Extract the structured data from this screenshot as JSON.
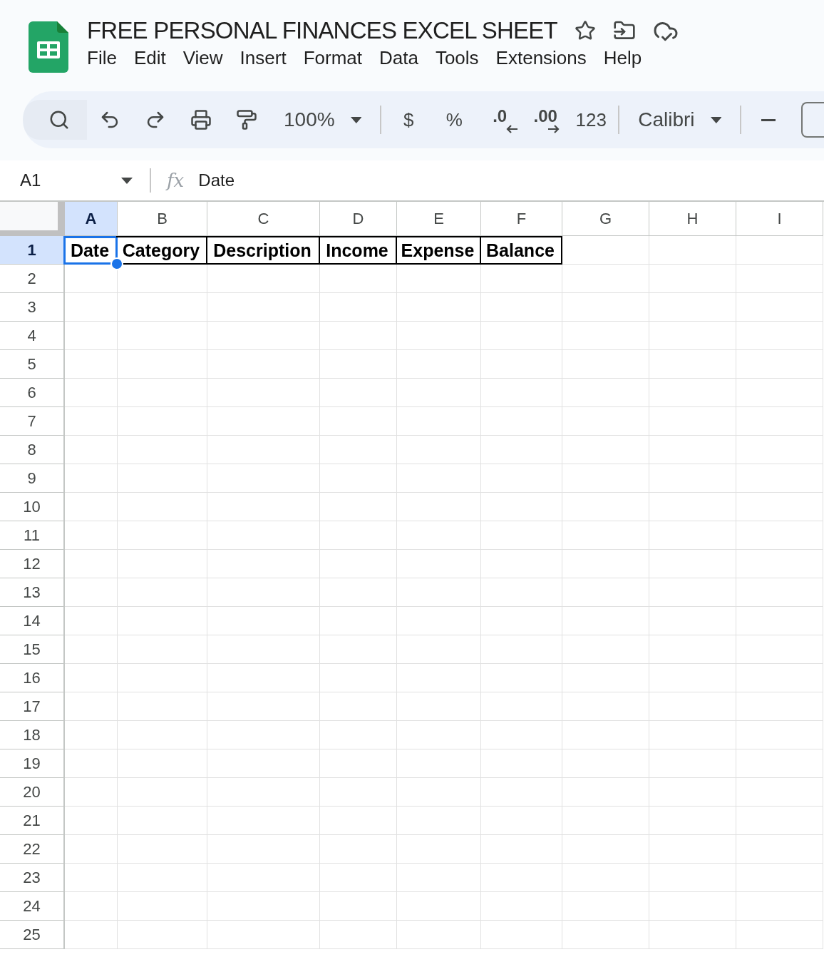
{
  "document": {
    "title": "FREE PERSONAL FINANCES EXCEL SHEET",
    "starred": false
  },
  "menu": [
    "File",
    "Edit",
    "View",
    "Insert",
    "Format",
    "Data",
    "Tools",
    "Extensions",
    "Help"
  ],
  "toolbar": [
    {
      "kind": "search"
    },
    {
      "kind": "undo"
    },
    {
      "kind": "redo"
    },
    {
      "kind": "print"
    },
    {
      "kind": "paint"
    },
    {
      "kind": "select",
      "label": "100%"
    },
    {
      "kind": "divider"
    },
    {
      "kind": "text",
      "label": "$"
    },
    {
      "kind": "text",
      "label": "%"
    },
    {
      "kind": "decimal-less",
      "label": ".0"
    },
    {
      "kind": "decimal-more",
      "label": ".00"
    },
    {
      "kind": "text",
      "label": "123"
    },
    {
      "kind": "divider"
    },
    {
      "kind": "select",
      "label": "Calibri"
    },
    {
      "kind": "divider"
    },
    {
      "kind": "minus"
    }
  ],
  "formula_bar": {
    "name_box": "A1",
    "fx_label": "fx",
    "formula": "Date"
  },
  "columns": [
    {
      "label": "A",
      "selected": true
    },
    {
      "label": "B",
      "selected": false
    },
    {
      "label": "C",
      "selected": false
    },
    {
      "label": "D",
      "selected": false
    },
    {
      "label": "E",
      "selected": false
    },
    {
      "label": "F",
      "selected": false
    },
    {
      "label": "G",
      "selected": false
    },
    {
      "label": "H",
      "selected": false
    },
    {
      "label": "I",
      "selected": false
    }
  ],
  "rows": [
    {
      "label": "1",
      "selected": true
    },
    {
      "label": "2",
      "selected": false
    },
    {
      "label": "3",
      "selected": false
    },
    {
      "label": "4",
      "selected": false
    },
    {
      "label": "5",
      "selected": false
    },
    {
      "label": "6",
      "selected": false
    },
    {
      "label": "7",
      "selected": false
    },
    {
      "label": "8",
      "selected": false
    },
    {
      "label": "9",
      "selected": false
    },
    {
      "label": "10",
      "selected": false
    },
    {
      "label": "11",
      "selected": false
    },
    {
      "label": "12",
      "selected": false
    },
    {
      "label": "13",
      "selected": false
    },
    {
      "label": "14",
      "selected": false
    },
    {
      "label": "15",
      "selected": false
    },
    {
      "label": "16",
      "selected": false
    },
    {
      "label": "17",
      "selected": false
    },
    {
      "label": "18",
      "selected": false
    },
    {
      "label": "19",
      "selected": false
    },
    {
      "label": "20",
      "selected": false
    },
    {
      "label": "21",
      "selected": false
    },
    {
      "label": "22",
      "selected": false
    },
    {
      "label": "23",
      "selected": false
    },
    {
      "label": "24",
      "selected": false
    },
    {
      "label": "25",
      "selected": false
    }
  ],
  "cells": [
    {
      "text": "Date",
      "selected": true
    },
    {
      "text": "Category",
      "selected": false
    },
    {
      "text": "Description",
      "selected": false
    },
    {
      "text": "Income",
      "selected": false
    },
    {
      "text": "Expense",
      "selected": false
    },
    {
      "text": "Balance",
      "selected": false
    }
  ]
}
